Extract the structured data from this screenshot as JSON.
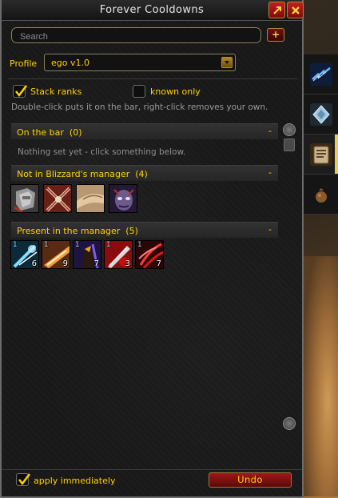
{
  "window": {
    "title": "Forever Cooldowns"
  },
  "search": {
    "placeholder": "Search",
    "add_label": "+"
  },
  "profile": {
    "label": "Profile",
    "value": "ego v1.0"
  },
  "options": {
    "stack_ranks": {
      "label": "Stack ranks",
      "checked": true
    },
    "known_only": {
      "label": "known only",
      "checked": false
    }
  },
  "hint": "Double-click puts it on the bar, right-click removes your own.",
  "sections": {
    "on_bar": {
      "title": "On the bar",
      "count": "(0)",
      "collapse": "-",
      "empty_text": "Nothing set yet - click something below."
    },
    "not_in_manager": {
      "title": "Not in Blizzard's manager",
      "count": "(4)",
      "collapse": "-"
    },
    "in_manager": {
      "title": "Present in the manager",
      "count": "(5)",
      "collapse": "-"
    }
  },
  "not_in_manager_icons": [
    {
      "icon": "shield-wall-icon"
    },
    {
      "icon": "crossed-axes-icon"
    },
    {
      "icon": "gauze-arm-icon"
    },
    {
      "icon": "demonic-face-icon"
    }
  ],
  "in_manager_icons": [
    {
      "icon": "frost-strike-icon",
      "rank": "1",
      "count": "6"
    },
    {
      "icon": "flame-slash-icon",
      "rank": "1",
      "count": "9"
    },
    {
      "icon": "shadow-warrior-icon",
      "rank": "1",
      "count": "7"
    },
    {
      "icon": "bloody-blade-icon",
      "rank": "1",
      "count": "3"
    },
    {
      "icon": "red-claw-icon",
      "rank": "1",
      "count": "7"
    }
  ],
  "footer": {
    "apply_label": "apply immediately",
    "apply_checked": true,
    "undo_label": "Undo"
  },
  "colors": {
    "accent_gold": "#ffd100",
    "button_red": "#a01818",
    "active_tab": "#f2c94c"
  }
}
